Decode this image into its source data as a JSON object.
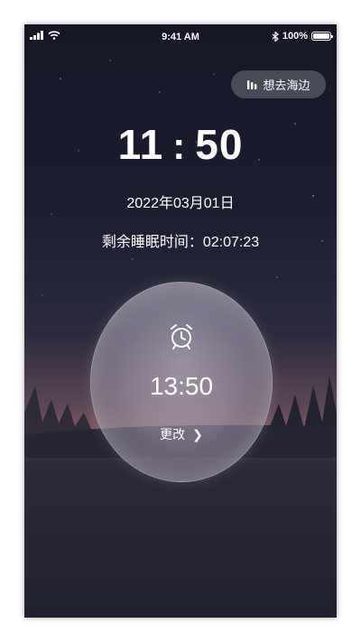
{
  "status_bar": {
    "time": "9:41 AM",
    "battery": "100%",
    "icons": [
      "signal-icon",
      "wifi-icon",
      "bluetooth-icon",
      "battery-icon"
    ]
  },
  "sound": {
    "label": "想去海边",
    "icon": "sound-bars-icon"
  },
  "clock": {
    "hours": "11",
    "separator": ":",
    "minutes": "50"
  },
  "date": "2022年03月01日",
  "remaining_sleep": "剩余睡眠时间：02:07:23",
  "alarm": {
    "icon": "alarm-clock-icon",
    "time": "13:50",
    "change_label": "更改",
    "chevron": "chevron-right-icon"
  },
  "colors": {
    "sky_top": "#151626",
    "horizon_glow": "#7b5560",
    "ground": "#1f2030",
    "text": "#ffffff"
  }
}
